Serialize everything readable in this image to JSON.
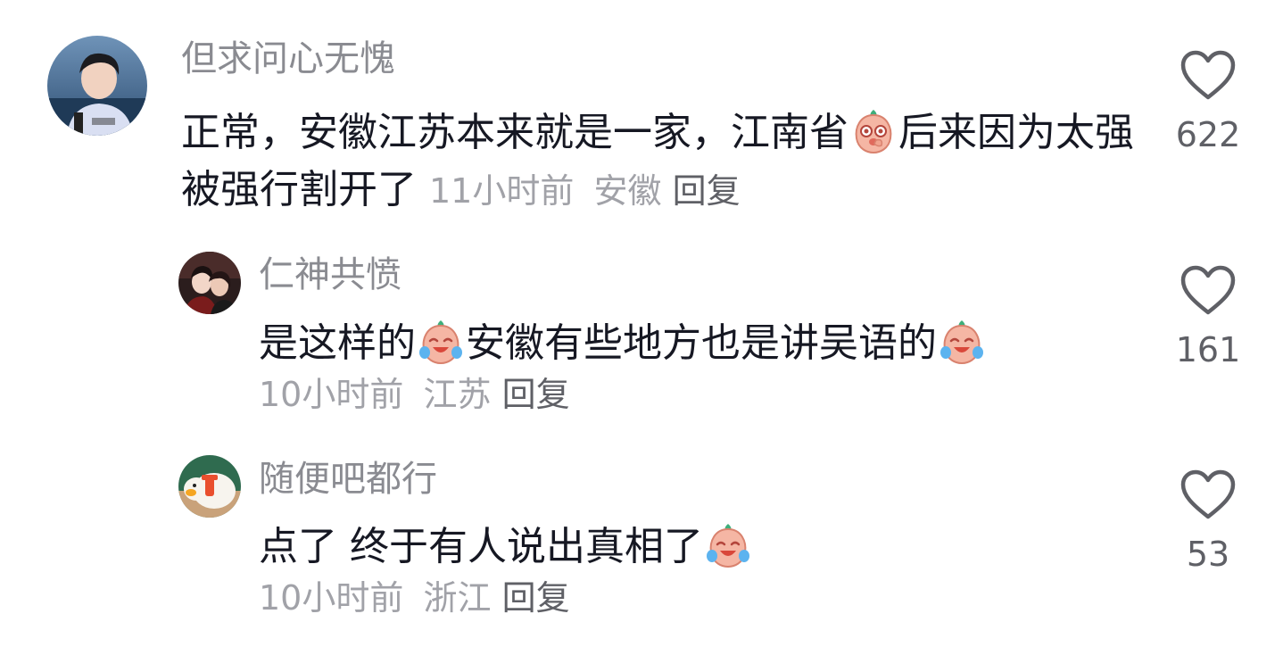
{
  "comments": [
    {
      "username": "但求问心无愧",
      "text_part1": "正常，安徽江苏本来就是一家，江南省",
      "emoji1": "blushing-peach-emoji",
      "text_part2": "后来因为太强被强行割开了",
      "time": "11小时前",
      "location": "安徽",
      "reply_label": "回复",
      "likes": "622",
      "avatar": "young-man-avatar"
    },
    {
      "username": "仁神共愤",
      "text_part1": "是这样的",
      "emoji1": "crying-laughing-peach-emoji",
      "text_part2": "安徽有些地方也是讲吴语的",
      "emoji2": "crying-laughing-peach-emoji",
      "time": "10小时前",
      "location": "江苏",
      "reply_label": "回复",
      "likes": "161",
      "avatar": "couple-avatar"
    },
    {
      "username": "随便吧都行",
      "text_part1": "点了 终于有人说出真相了",
      "emoji1": "crying-laughing-peach-emoji",
      "time": "10小时前",
      "location": "浙江",
      "reply_label": "回复",
      "likes": "53",
      "avatar": "duck-toy-avatar"
    }
  ],
  "colors": {
    "username": "#8a8b91",
    "text": "#161823",
    "meta": "#a1a2a8",
    "reply": "#5f6066",
    "heart_outline": "#5f6066"
  }
}
